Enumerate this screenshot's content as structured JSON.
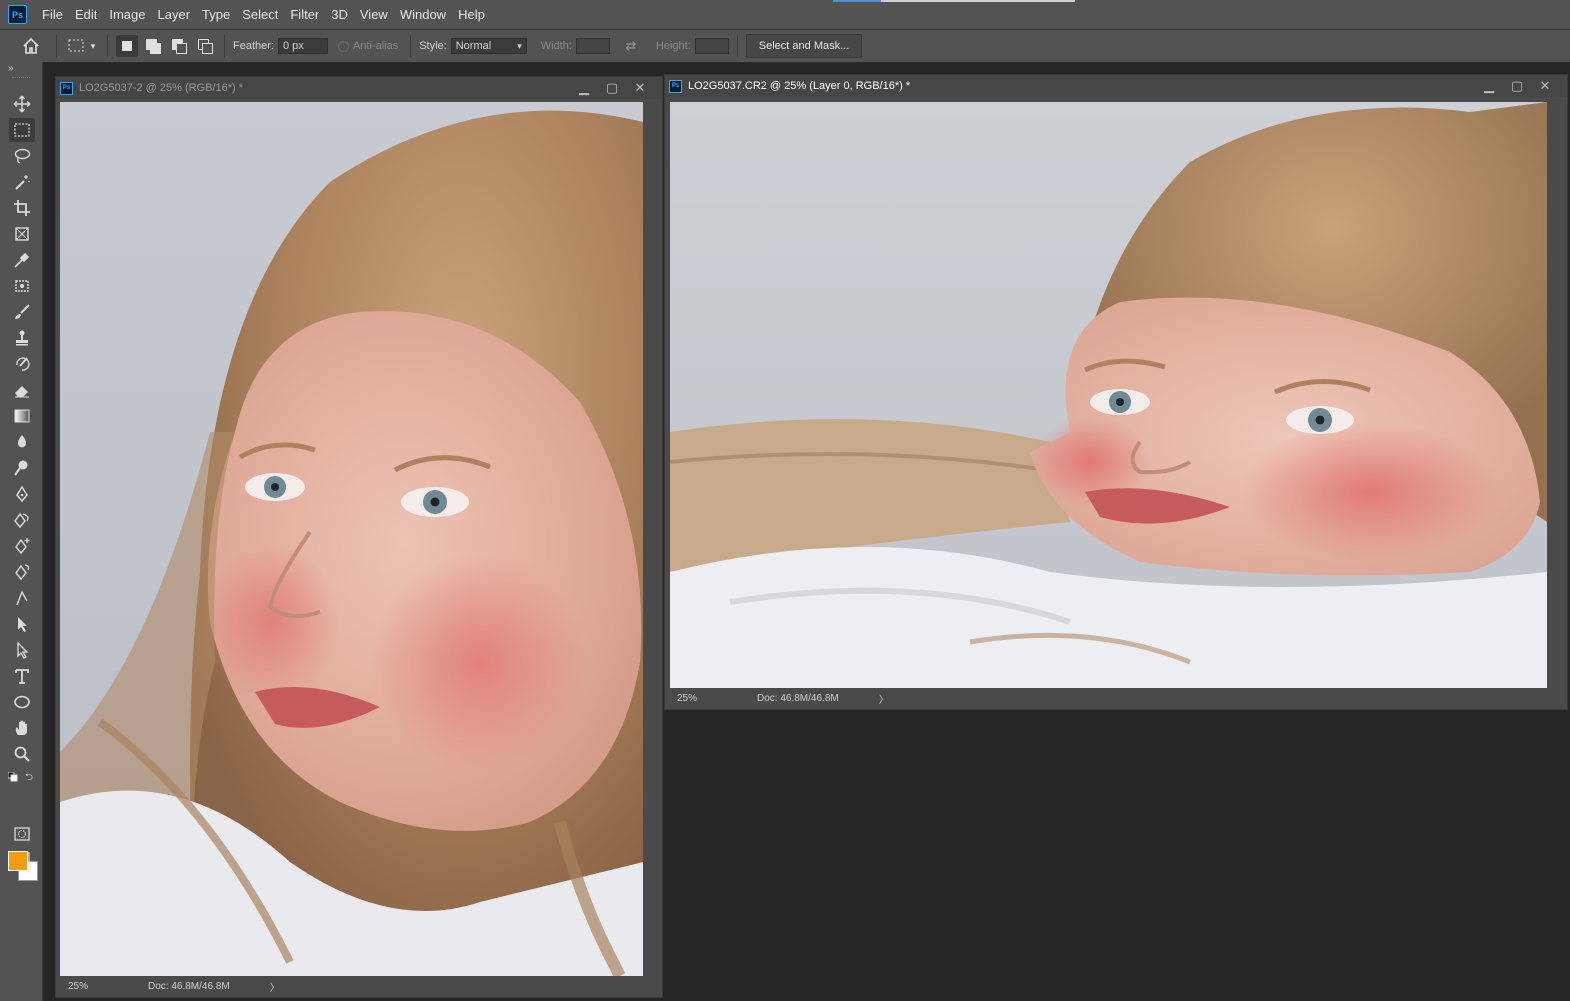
{
  "app": {
    "logo": "Ps"
  },
  "menu": [
    "File",
    "Edit",
    "Image",
    "Layer",
    "Type",
    "Select",
    "Filter",
    "3D",
    "View",
    "Window",
    "Help"
  ],
  "options": {
    "feather_label": "Feather:",
    "feather_value": "0 px",
    "antialias_label": "Anti-alias",
    "style_label": "Style:",
    "style_value": "Normal",
    "width_label": "Width:",
    "height_label": "Height:",
    "select_mask_label": "Select and Mask..."
  },
  "colors": {
    "foreground": "#f39c12",
    "background": "#ffffff",
    "accent": "#31a8ff"
  },
  "tools": [
    "move-icon",
    "rectangular-marquee-icon",
    "lasso-icon",
    "magic-wand-icon",
    "crop-icon",
    "frame-icon",
    "eyedropper-icon",
    "spot-healing-icon",
    "brush-icon",
    "clone-stamp-icon",
    "history-brush-icon",
    "eraser-icon",
    "gradient-icon",
    "blur-icon",
    "dodge-icon",
    "pen-icon",
    "freeform-pen-icon",
    "add-anchor-icon",
    "curvature-pen-icon",
    "convert-point-icon",
    "path-selection-icon",
    "direct-selection-icon",
    "type-icon",
    "ellipse-icon",
    "hand-icon",
    "zoom-icon"
  ],
  "documents": [
    {
      "title": "LO2G5037-2 @ 25% (RGB/16*) *",
      "zoom": "25%",
      "doc_size": "Doc: 46.8M/46.8M",
      "active": false
    },
    {
      "title": "LO2G5037.CR2 @ 25% (Layer 0, RGB/16*) *",
      "zoom": "25%",
      "doc_size": "Doc: 46.8M/46.8M",
      "active": true
    }
  ]
}
